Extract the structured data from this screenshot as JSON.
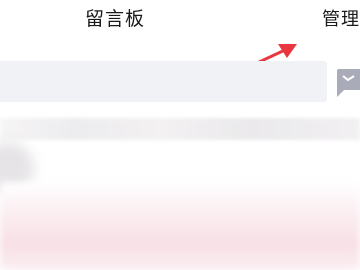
{
  "nav": {
    "title": "留言板",
    "manage_label": "管理"
  },
  "colors": {
    "arrow": "#e8383d",
    "search_bg": "#f1f2f6",
    "icon": "#a9abb8"
  },
  "icons": {
    "message": "message-icon",
    "arrow": "annotation-arrow"
  }
}
